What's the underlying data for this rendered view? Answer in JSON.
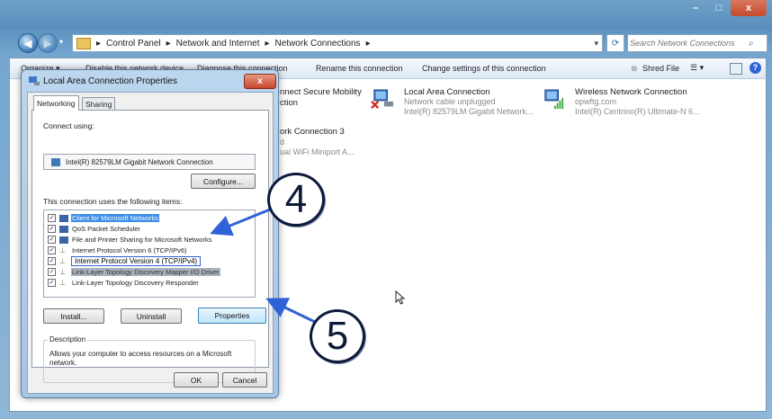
{
  "window": {
    "minimize": "–",
    "maximize": "□",
    "close": "x"
  },
  "address": {
    "breadcrumbs": [
      "Control Panel",
      "Network and Internet",
      "Network Connections"
    ],
    "separator": "▸",
    "search_placeholder": "Search Network Connections"
  },
  "commandbar": {
    "organize": "Organize ▾",
    "disable": "Disable this network device",
    "diagnose": "Diagnose this connection",
    "rename": "Rename this connection",
    "change": "Change settings of this connection",
    "shred": "Shred File"
  },
  "connections": [
    {
      "title": "Local Area Connection",
      "line1": "Network cable unplugged",
      "line2": "Intel(R) 82579LM Gigabit Network..."
    },
    {
      "title": "Wireless Network Connection",
      "line1": "opwftg.com",
      "line2": "Intel(R) Centrino(R) Ultimate-N 6..."
    },
    {
      "title_partial": "nnect Secure Mobility",
      "line1_partial": "ction"
    },
    {
      "title_partial": "ork Connection 3",
      "line1_partial": "d",
      "line2_partial": "ual WiFi Miniport A..."
    }
  ],
  "dialog": {
    "title": "Local Area Connection Properties",
    "close": "x",
    "tabs": [
      "Networking",
      "Sharing"
    ],
    "connect_using_label": "Connect using:",
    "adapter": "Intel(R) 82579LM Gigabit Network Connection",
    "configure_button": "Configure...",
    "items_label": "This connection uses the following items:",
    "items": [
      {
        "label": "Client for Microsoft Networks",
        "checked": true,
        "selected": true
      },
      {
        "label": "QoS Packet Scheduler",
        "checked": true,
        "selected": false
      },
      {
        "label": "File and Printer Sharing for Microsoft Networks",
        "checked": true,
        "selected": false
      },
      {
        "label": "Internet Protocol Version 6 (TCP/IPv6)",
        "checked": true,
        "selected": false
      },
      {
        "label": "Internet Protocol Version 4 (TCP/IPv4)",
        "checked": true,
        "selected": false,
        "highlighted": true
      },
      {
        "label": "Link-Layer Topology Discovery Mapper I/O Driver",
        "checked": true,
        "selected": false
      },
      {
        "label": "Link-Layer Topology Discovery Responder",
        "checked": true,
        "selected": false
      }
    ],
    "install_button": "Install...",
    "uninstall_button": "Uninstall",
    "properties_button": "Properties",
    "description_label": "Description",
    "description_text": "Allows your computer to access resources on a Microsoft network.",
    "ok_button": "OK",
    "cancel_button": "Cancel"
  },
  "callouts": {
    "step4": "4",
    "step5": "5"
  },
  "colors": {
    "accent": "#2f62d6",
    "callout_outline": "#0d1a3a",
    "selection": "#3d8ee8"
  }
}
